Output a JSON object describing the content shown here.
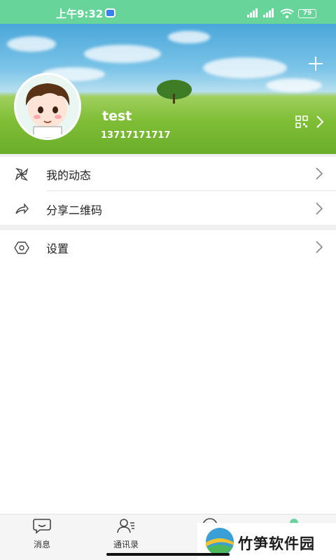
{
  "status_bar": {
    "time": "上午9:32",
    "battery": "79"
  },
  "profile": {
    "add_icon": "plus-icon",
    "username": "test",
    "phone": "13717171717",
    "qr_icon": "qr-code-icon"
  },
  "menu": [
    {
      "label": "我的动态",
      "icon": "pinwheel-icon"
    },
    {
      "label": "分享二维码",
      "icon": "share-icon"
    },
    {
      "label": "设置",
      "icon": "settings-icon"
    }
  ],
  "nav": [
    {
      "label": "消息",
      "icon": "chat-bubble-icon"
    },
    {
      "label": "通讯录",
      "icon": "contacts-icon"
    }
  ],
  "watermark": {
    "text": "竹笋软件园"
  },
  "colors": {
    "accent": "#67d49a",
    "background": "#ffffff",
    "divider": "#e5e5e5"
  }
}
